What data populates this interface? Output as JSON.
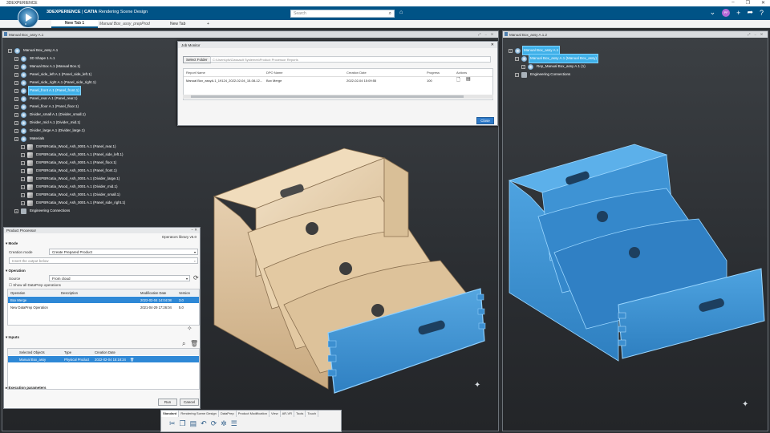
{
  "titlebar": {
    "title": "3DEXPERIENCE"
  },
  "app": {
    "brand_prefix": "3DEXPERIENCE",
    "brand_app": "CATIA",
    "brand_role": "Rendering Scene Design",
    "compass_version": "R",
    "search_placeholder": "Search"
  },
  "tabs": [
    {
      "label": "New Tab 1"
    },
    {
      "label": "Manual Box_assy_prepProd"
    },
    {
      "label": "New Tab"
    },
    {
      "label": "+"
    }
  ],
  "left_pane": {
    "title": "Manual Box_assy A.1",
    "tree": [
      {
        "label": "Manual Box_assy A.1",
        "indent": 0,
        "icon": "product-icon",
        "selected": false
      },
      {
        "label": "3D Shape 1 A.1",
        "indent": 1,
        "icon": "part-icon",
        "selected": false
      },
      {
        "label": "Manual Box A.1 (Manual Box.1)",
        "indent": 1,
        "icon": "product-icon",
        "selected": false
      },
      {
        "label": "Panel_side_left A.1 (Panel_side_left.1)",
        "indent": 1,
        "icon": "product-icon",
        "selected": false
      },
      {
        "label": "Panel_side_right A.1 (Panel_side_right.1)",
        "indent": 1,
        "icon": "product-icon",
        "selected": false
      },
      {
        "label": "Panel_front A.1 (Panel_front.1)",
        "indent": 1,
        "icon": "product-icon",
        "selected": true
      },
      {
        "label": "Panel_rear A.1 (Panel_rear.1)",
        "indent": 1,
        "icon": "product-icon",
        "selected": false
      },
      {
        "label": "Panel_floor A.1 (Panel_floor.1)",
        "indent": 1,
        "icon": "product-icon",
        "selected": false
      },
      {
        "label": "Divider_small A.1 (Divider_small.1)",
        "indent": 1,
        "icon": "product-icon",
        "selected": false
      },
      {
        "label": "Divider_mid A.1 (Divider_mid.1)",
        "indent": 1,
        "icon": "product-icon",
        "selected": false
      },
      {
        "label": "Divider_large A.1 (Divider_large.1)",
        "indent": 1,
        "icon": "product-icon",
        "selected": false
      },
      {
        "label": "Materials",
        "indent": 1,
        "icon": "folder-icon",
        "selected": false
      },
      {
        "label": "DSPBRcatia_Wood_Ash_0001 A.1 (Panel_rear.1)",
        "indent": 2,
        "icon": "material-icon",
        "selected": false
      },
      {
        "label": "DSPBRcatia_Wood_Ash_0001 A.1 (Panel_side_left.1)",
        "indent": 2,
        "icon": "material-icon",
        "selected": false
      },
      {
        "label": "DSPBRcatia_Wood_Ash_0001 A.1 (Panel_floor.1)",
        "indent": 2,
        "icon": "material-icon",
        "selected": false
      },
      {
        "label": "DSPBRcatia_Wood_Ash_0001 A.1 (Panel_front.1)",
        "indent": 2,
        "icon": "material-icon",
        "selected": false
      },
      {
        "label": "DSPBRcatia_Wood_Ash_0001 A.1 (Divider_large.1)",
        "indent": 2,
        "icon": "material-icon",
        "selected": false
      },
      {
        "label": "DSPBRcatia_Wood_Ash_0001 A.1 (Divider_mid.1)",
        "indent": 2,
        "icon": "material-icon",
        "selected": false
      },
      {
        "label": "DSPBRcatia_Wood_Ash_0001 A.1 (Divider_small.1)",
        "indent": 2,
        "icon": "material-icon",
        "selected": false
      },
      {
        "label": "DSPBRcatia_Wood_Ash_0001 A.1 (Panel_side_right.1)",
        "indent": 2,
        "icon": "material-icon",
        "selected": false
      },
      {
        "label": "Engineering Connections",
        "indent": 1,
        "icon": "gear-icon",
        "selected": false
      }
    ]
  },
  "right_pane": {
    "title": "Manual Box_assy A.1.2",
    "tree": [
      {
        "label": "Manual Box_assy A.1",
        "indent": 0,
        "icon": "product-icon",
        "selected": true
      },
      {
        "label": "Manual Box_assy A.1 (Manual Box_assy)",
        "indent": 1,
        "icon": "product-icon",
        "selected": true
      },
      {
        "label": "Rep_Manual Box_assy A.1 (1)",
        "indent": 2,
        "icon": "rep-icon",
        "selected": false
      },
      {
        "label": "Engineering Connections",
        "indent": 1,
        "icon": "gear-icon",
        "selected": false
      }
    ]
  },
  "job_monitor": {
    "title": "Job Monitor",
    "select_folder": "Select Folder",
    "path": "C:\\Users\\pfu\\Dassault Systemes\\Product Processor Reports",
    "columns": [
      "Report Name",
      "DPO Name",
      "Creation Date",
      "Progress",
      "Actions"
    ],
    "rows": [
      {
        "report": "Manual Box_assyA.1_19124_2022-02-04_15-08-12...",
        "dpo": "Box Merge",
        "date": "2022-02-04 15:09:55",
        "progress": "100"
      }
    ],
    "close": "Close"
  },
  "product_processor": {
    "title": "Product Processor",
    "library": "Operators library v5.0",
    "mode_section": "Mode",
    "creation_mode_label": "Creation mode",
    "creation_mode_value": "Create Prepared Product",
    "insert_output_placeholder": "Insert the output below",
    "operation_section": "Operation",
    "source_label": "Source",
    "source_value": "From cloud",
    "show_all_label": "Show all DataPrep operations",
    "op_columns": [
      "Operation",
      "Description",
      "Modification Date",
      "Version"
    ],
    "op_rows": [
      {
        "op": "Box Merge",
        "desc": "",
        "date": "2022-02-04 14:04:08",
        "ver": "3.0",
        "selected": true
      },
      {
        "op": "New DataPrep Operation",
        "desc": "",
        "date": "2021-04-29 17:26:04",
        "ver": "5.0",
        "selected": false
      }
    ],
    "inputs_section": "Inputs",
    "in_columns": [
      "Selected Objects",
      "Type",
      "Creation Date"
    ],
    "in_rows": [
      {
        "obj": "Manual Box_assy",
        "type": "Physical Product",
        "date": "2022-02-04 15:18:24",
        "selected": true
      }
    ],
    "exec_section": "Execution parameters",
    "run": "Run",
    "cancel": "Cancel"
  },
  "toolbar": {
    "tabs": [
      "Standard",
      "Rendering Scene Design",
      "DataPrep",
      "Product Modification",
      "View",
      "AR-VR",
      "Tools",
      "Touch"
    ],
    "active": "Standard"
  },
  "colors": {
    "accent": "#005386",
    "selection": "#3fb0e8",
    "box_blue": "#3c8fd0",
    "wood": "#e9d3b5"
  }
}
